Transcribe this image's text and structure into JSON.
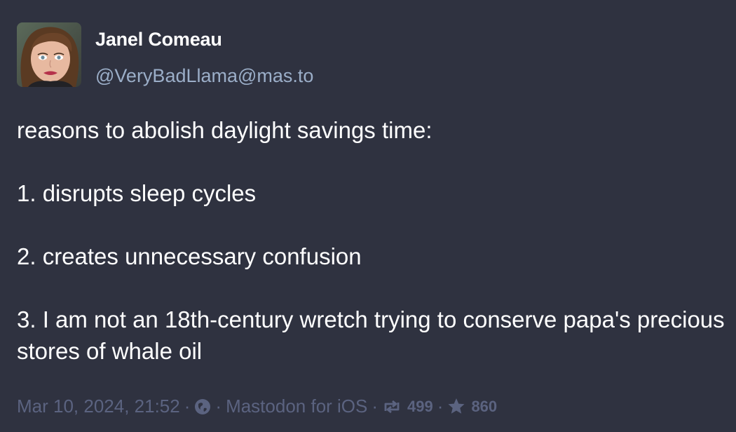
{
  "author": {
    "display_name": "Janel Comeau",
    "handle": "@VeryBadLlama@mas.to"
  },
  "post": {
    "lines": [
      "reasons to abolish daylight savings time:",
      "1. disrupts sleep cycles",
      "2. creates unnecessary confusion",
      "3. I am not an 18th-century wretch trying to conserve papa's precious stores of whale oil"
    ]
  },
  "footer": {
    "timestamp": "Mar 10, 2024, 21:52",
    "separator": "·",
    "visibility_icon": "globe-icon",
    "application": "Mastodon for iOS",
    "boost_icon": "boost-icon",
    "boosts": "499",
    "favourite_icon": "star-icon",
    "favourites": "860"
  },
  "colors": {
    "background": "#2f3240",
    "text": "#ffffff",
    "handle": "#9baec8",
    "meta": "#5b6380"
  }
}
